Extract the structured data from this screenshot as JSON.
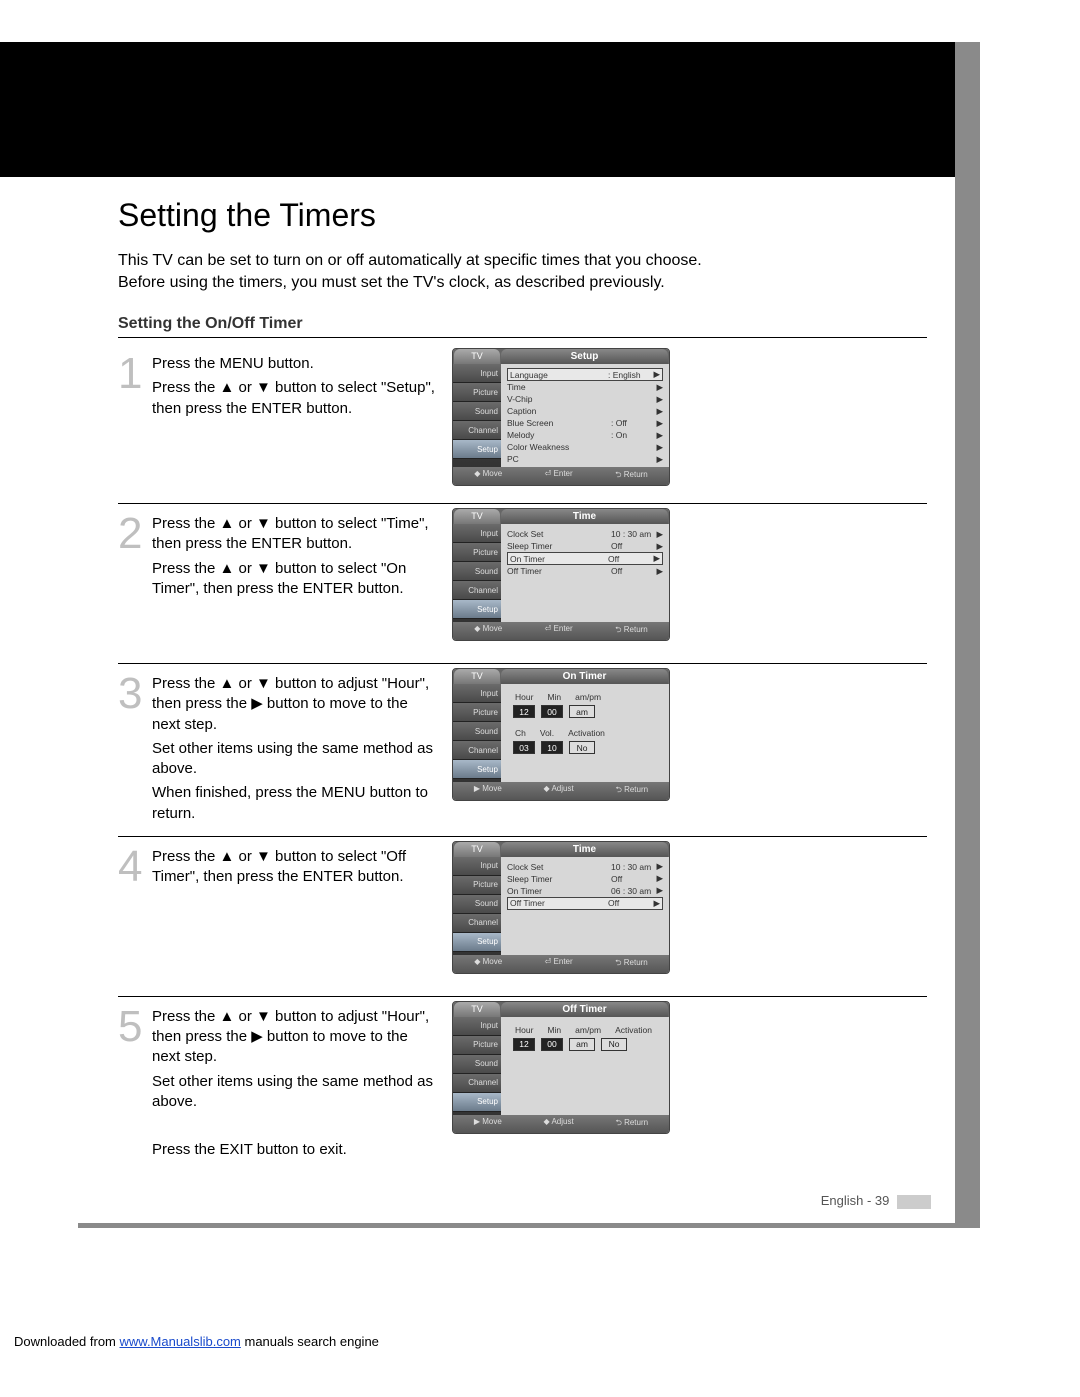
{
  "title": "Setting the Timers",
  "intro": "This TV can be set to turn on or off automatically at specific times that you choose. Before using the timers, you must set the TV's clock, as described previously.",
  "subhead": "Setting the On/Off Timer",
  "steps": [
    {
      "num": "1",
      "paras": [
        "Press the MENU button.",
        "Press the ▲ or ▼ button to select \"Setup\", then press the ENTER button."
      ],
      "osd": {
        "tv": "TV",
        "title": "Setup",
        "side": [
          "Input",
          "Picture",
          "Sound",
          "Channel",
          "Setup"
        ],
        "side_sel": 4,
        "list": [
          {
            "lbl": "Language",
            "val": ": English",
            "arw": "▶",
            "boxed": true
          },
          {
            "lbl": "Time",
            "val": "",
            "arw": "▶"
          },
          {
            "lbl": "V-Chip",
            "val": "",
            "arw": "▶"
          },
          {
            "lbl": "Caption",
            "val": "",
            "arw": "▶"
          },
          {
            "lbl": "Blue Screen",
            "val": ": Off",
            "arw": "▶"
          },
          {
            "lbl": "Melody",
            "val": ": On",
            "arw": "▶"
          },
          {
            "lbl": "Color Weakness",
            "val": "",
            "arw": "▶"
          },
          {
            "lbl": "PC",
            "val": "",
            "arw": "▶"
          }
        ],
        "foot": [
          "◆ Move",
          "⏎ Enter",
          "⮌ Return"
        ]
      }
    },
    {
      "num": "2",
      "paras": [
        "Press the ▲ or ▼ button to select \"Time\", then press the ENTER button.",
        "Press the ▲ or ▼ button to select \"On Timer\", then press the ENTER button."
      ],
      "osd": {
        "tv": "TV",
        "title": "Time",
        "side": [
          "Input",
          "Picture",
          "Sound",
          "Channel",
          "Setup"
        ],
        "side_sel": 4,
        "list": [
          {
            "lbl": "Clock Set",
            "val": "10 : 30  am",
            "arw": "▶"
          },
          {
            "lbl": "Sleep Timer",
            "val": "Off",
            "arw": "▶"
          },
          {
            "lbl": "On Timer",
            "val": "Off",
            "arw": "▶",
            "boxed": true
          },
          {
            "lbl": "Off Timer",
            "val": "Off",
            "arw": "▶"
          }
        ],
        "foot": [
          "◆ Move",
          "⏎ Enter",
          "⮌ Return"
        ]
      }
    },
    {
      "num": "3",
      "paras": [
        "Press the ▲ or ▼ button to adjust \"Hour\", then press the ▶ button to move to the next step.",
        "Set other items using the same method as above.",
        "When finished, press the MENU button to return."
      ],
      "osd": {
        "tv": "TV",
        "title": "On Timer",
        "side": [
          "Input",
          "Picture",
          "Sound",
          "Channel",
          "Setup"
        ],
        "side_sel": 4,
        "timer": {
          "row1_labels": [
            "Hour",
            "Min",
            "am/pm"
          ],
          "row1_vals": [
            {
              "v": "12",
              "dark": true
            },
            {
              "v": "00",
              "dark": true
            },
            {
              "v": "am",
              "dark": false
            }
          ],
          "row2_labels": [
            "Ch",
            "Vol.",
            "Activation"
          ],
          "row2_vals": [
            {
              "v": "03",
              "dark": true
            },
            {
              "v": "10",
              "dark": true
            },
            {
              "v": "No",
              "dark": false
            }
          ]
        },
        "foot": [
          "▶ Move",
          "◆ Adjust",
          "⮌ Return"
        ]
      }
    },
    {
      "num": "4",
      "paras": [
        "Press the ▲ or ▼ button to select \"Off Timer\", then press the ENTER button."
      ],
      "osd": {
        "tv": "TV",
        "title": "Time",
        "side": [
          "Input",
          "Picture",
          "Sound",
          "Channel",
          "Setup"
        ],
        "side_sel": 4,
        "list": [
          {
            "lbl": "Clock Set",
            "val": "10 : 30  am",
            "arw": "▶"
          },
          {
            "lbl": "Sleep Timer",
            "val": "Off",
            "arw": "▶"
          },
          {
            "lbl": "On Timer",
            "val": "06 : 30  am",
            "arw": "▶"
          },
          {
            "lbl": "Off Timer",
            "val": "Off",
            "arw": "▶",
            "boxed": true
          }
        ],
        "foot": [
          "◆ Move",
          "⏎ Enter",
          "⮌ Return"
        ]
      }
    },
    {
      "num": "5",
      "paras": [
        "Press the ▲ or ▼ button to adjust \"Hour\", then press the ▶ button to move to the next step.",
        "Set other items using the same method as above.",
        "",
        "Press the EXIT button to exit."
      ],
      "osd": {
        "tv": "TV",
        "title": "Off Timer",
        "side": [
          "Input",
          "Picture",
          "Sound",
          "Channel",
          "Setup"
        ],
        "side_sel": 4,
        "timer": {
          "row1_labels": [
            "Hour",
            "Min",
            "am/pm",
            "Activation"
          ],
          "row1_vals": [
            {
              "v": "12",
              "dark": true
            },
            {
              "v": "00",
              "dark": true
            },
            {
              "v": "am",
              "dark": false
            },
            {
              "v": "No",
              "dark": false
            }
          ]
        },
        "foot": [
          "▶ Move",
          "◆ Adjust",
          "⮌ Return"
        ]
      }
    }
  ],
  "pagefoot": "English - 39",
  "download": {
    "pre": "Downloaded from ",
    "link": "www.Manualslib.com",
    "post": "  manuals search engine"
  }
}
